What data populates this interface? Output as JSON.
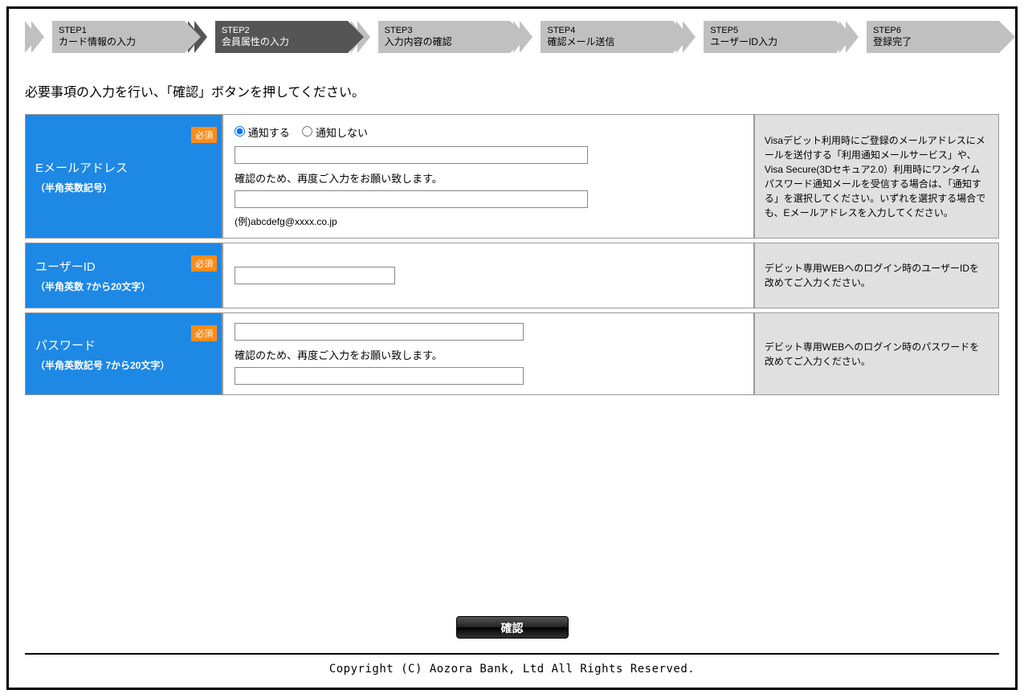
{
  "steps": [
    {
      "num": "STEP1",
      "label": "カード情報の入力"
    },
    {
      "num": "STEP2",
      "label": "会員属性の入力"
    },
    {
      "num": "STEP3",
      "label": "入力内容の確認"
    },
    {
      "num": "STEP4",
      "label": "確認メール送信"
    },
    {
      "num": "STEP5",
      "label": "ユーザーID入力"
    },
    {
      "num": "STEP6",
      "label": "登録完了"
    }
  ],
  "active_step": 1,
  "instruction": "必要事項の入力を行い、「確認」ボタンを押してください。",
  "required_label": "必須",
  "fields": {
    "email": {
      "label": "Eメールアドレス",
      "sub": "（半角英数記号）",
      "radio_notify": "通知する",
      "radio_no_notify": "通知しない",
      "confirm_text": "確認のため、再度ご入力をお願い致します。",
      "example": "(例)abcdefg@xxxx.co.jp",
      "help": "Visaデビット利用時にご登録のメールアドレスにメールを送付する「利用通知メールサービス」や、Visa Secure(3Dセキュア2.0）利用時にワンタイムパスワード通知メールを受信する場合は、「通知する」を選択してください。いずれを選択する場合でも、Eメールアドレスを入力してください。"
    },
    "userid": {
      "label": "ユーザーID",
      "sub": "（半角英数 7から20文字）",
      "help": "デビット専用WEBへのログイン時のユーザーIDを改めてご入力ください。"
    },
    "password": {
      "label": "パスワード",
      "sub": "（半角英数記号 7から20文字）",
      "confirm_text": "確認のため、再度ご入力をお願い致します。",
      "help": "デビット専用WEBへのログイン時のパスワードを改めてご入力ください。"
    }
  },
  "confirm_button": "確認",
  "copyright": "Copyright (C) Aozora Bank, Ltd All Rights Reserved."
}
